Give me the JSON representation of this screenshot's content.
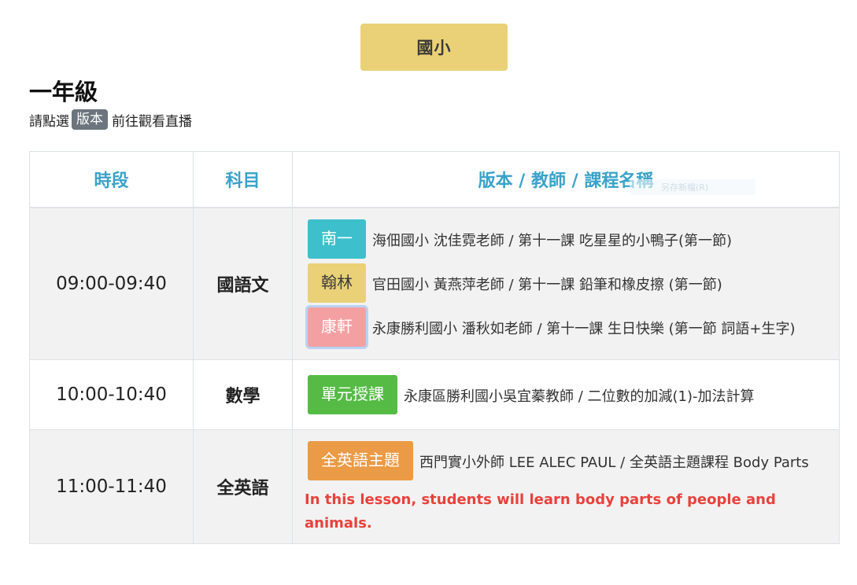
{
  "level_button": "國小",
  "grade_title": "一年級",
  "instruction": {
    "before": "請點選",
    "chip": "版本",
    "after": "前往觀看直播"
  },
  "table": {
    "headers": [
      "時段",
      "科目",
      "版本 / 教師 / 課程名稱"
    ],
    "ghost_text": "另存新檔(R)",
    "rows": [
      {
        "time": "09:00-09:40",
        "subject": "國語文",
        "lessons": [
          {
            "tag": "南一",
            "color": "#3dbfcc",
            "text": "海佃國小 沈佳霓老師 / 第十一課 吃星星的小鴨子(第一節)"
          },
          {
            "tag": "翰林",
            "color": "#ead177",
            "text": "官田國小 黃燕萍老師 / 第十一課 鉛筆和橡皮擦 (第一節)"
          },
          {
            "tag": "康軒",
            "color": "#f4a0a3",
            "text": "永康勝利國小 潘秋如老師 / 第十一課 生日快樂 (第一節 詞語+生字)"
          }
        ]
      },
      {
        "time": "10:00-10:40",
        "subject": "數學",
        "lessons": [
          {
            "tag": "單元授課",
            "color": "#55bb45",
            "text": "永康區勝利國小吳宜蓁教師 / 二位數的加減(1)-加法計算"
          }
        ]
      },
      {
        "time": "11:00-11:40",
        "subject": "全英語",
        "lessons": [
          {
            "tag": "全英語主題",
            "color": "#eb9a45",
            "text": "西門實小外師 LEE ALEC PAUL / 全英語主題課程 Body Parts"
          }
        ],
        "note": "In this lesson, students will learn body parts of people and animals."
      }
    ]
  }
}
